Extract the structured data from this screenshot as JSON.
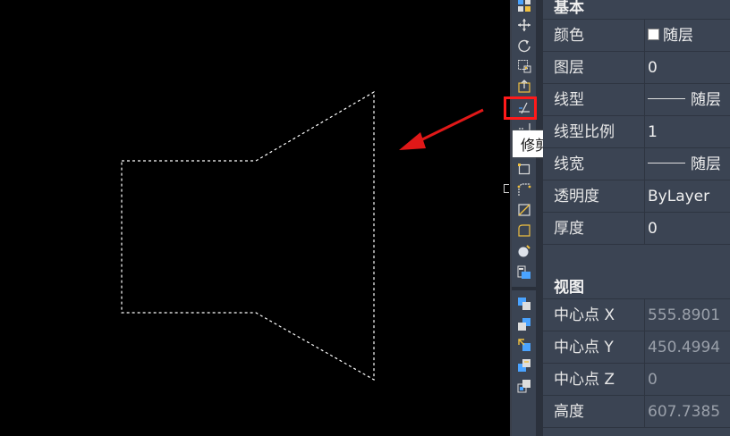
{
  "tooltip": {
    "text": "修剪"
  },
  "toolbar": {
    "icons": [
      "match-properties-icon",
      "move-icon",
      "rotate-icon",
      "scale-icon",
      "stretch-icon",
      "trim-icon",
      "extend-icon",
      "break-icon",
      "join-icon",
      "chamfer-icon",
      "fillet-icon",
      "explode-icon",
      "properties-icon",
      "bring-front-icon",
      "send-back-icon",
      "bring-above-icon",
      "send-under-icon",
      "bring-annotation-front-icon"
    ]
  },
  "properties": {
    "sections": [
      {
        "title": "基本"
      },
      {
        "title": "视图"
      }
    ],
    "basic": [
      {
        "label": "颜色",
        "value": "随层",
        "kind": "color",
        "color": "#ffffff"
      },
      {
        "label": "图层",
        "value": "0"
      },
      {
        "label": "线型",
        "value": "随层",
        "kind": "linetype"
      },
      {
        "label": "线型比例",
        "value": "1"
      },
      {
        "label": "线宽",
        "value": "随层",
        "kind": "linetype"
      },
      {
        "label": "透明度",
        "value": "ByLayer"
      },
      {
        "label": "厚度",
        "value": "0"
      }
    ],
    "view": [
      {
        "label": "中心点 X",
        "value": "555.8901"
      },
      {
        "label": "中心点 Y",
        "value": "450.4994"
      },
      {
        "label": "中心点 Z",
        "value": "0"
      },
      {
        "label": "高度",
        "value": "607.7385"
      }
    ]
  },
  "colors": {
    "accent_red": "#ff1a1a",
    "panel_bg": "#3b4453",
    "canvas_bg": "#000000"
  }
}
